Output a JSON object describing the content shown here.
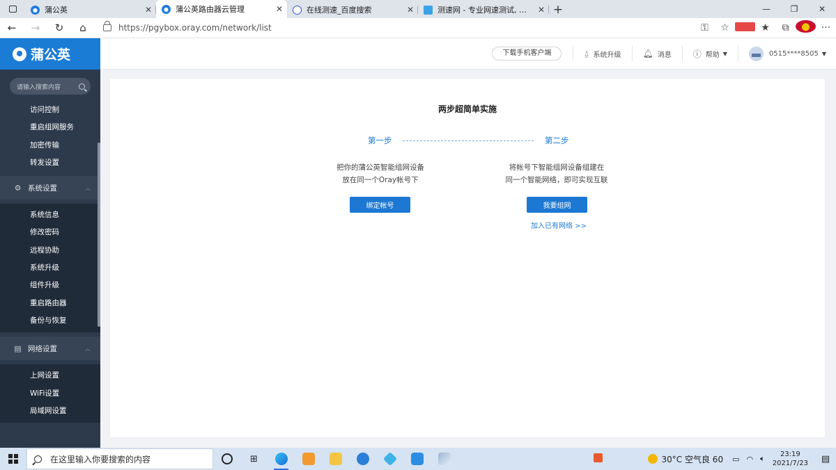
{
  "browser": {
    "tabs": [
      {
        "title": "蒲公英",
        "active": false
      },
      {
        "title": "蒲公英路由器云管理",
        "active": true
      },
      {
        "title": "在线测速_百度搜索",
        "active": false
      },
      {
        "title": "测速网 - 专业网速测试, 宽带提速",
        "active": false
      }
    ],
    "url": "https://pgybox.oray.com/network/list"
  },
  "sidebar": {
    "logo": "蒲公英",
    "search_placeholder": "请输入搜索内容",
    "top_items": [
      "访问控制",
      "重启组网服务",
      "加密传输",
      "转发设置"
    ],
    "groups": [
      {
        "title": "系统设置",
        "items": [
          "系统信息",
          "修改密码",
          "远程协助",
          "系统升级",
          "组件升级",
          "重启路由器",
          "备份与恢复"
        ]
      },
      {
        "title": "网络设置",
        "items": [
          "上网设置",
          "WiFi设置",
          "局域网设置"
        ]
      }
    ]
  },
  "topbar": {
    "download": "下载手机客户端",
    "upgrade": "系统升级",
    "messages": "消息",
    "help": "帮助",
    "account": "0515****8505"
  },
  "main": {
    "title": "两步超简单实施",
    "step1": {
      "label": "第一步",
      "line1": "把你的蒲公英智能组网设备",
      "line2": "放在同一个Oray帐号下",
      "button": "绑定帐号"
    },
    "step2": {
      "label": "第二步",
      "line1": "将帐号下智能组网设备组建在",
      "line2": "同一个智能网络，即可实现互联",
      "button": "我要组网",
      "link": "加入已有网络 >>"
    }
  },
  "taskbar": {
    "search_placeholder": "在这里输入你要搜索的内容",
    "weather": "30°C  空气良 60",
    "time": "23:19",
    "date": "2021/7/23"
  }
}
